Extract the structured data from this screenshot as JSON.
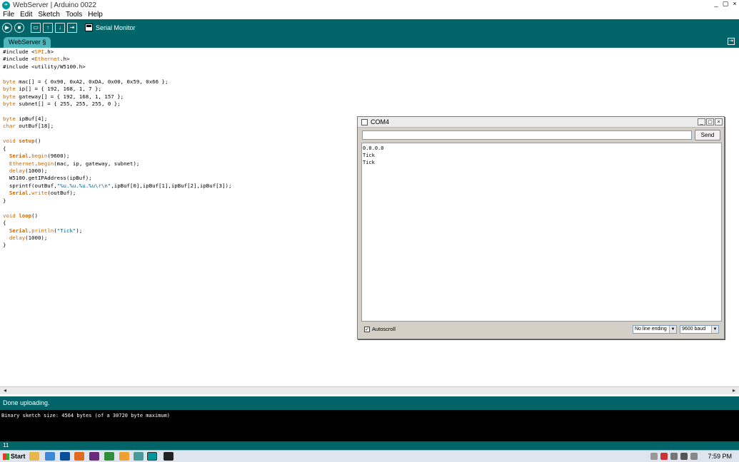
{
  "window": {
    "title": "WebServer | Arduino 0022",
    "controls": [
      "_",
      "▢",
      "×"
    ]
  },
  "menu": [
    "File",
    "Edit",
    "Sketch",
    "Tools",
    "Help"
  ],
  "toolbar": {
    "buttons": [
      "verify",
      "stop",
      "new",
      "open",
      "save",
      "upload"
    ],
    "serial_monitor_label": "Serial Monitor"
  },
  "tab": {
    "label": "WebServer §"
  },
  "editor": {
    "lines": [
      [
        [
          "",
          "#include <"
        ],
        [
          "kw",
          "SPI"
        ],
        [
          "",
          ".h>"
        ]
      ],
      [
        [
          "",
          "#include <"
        ],
        [
          "kw",
          "Ethernet"
        ],
        [
          "",
          ".h>"
        ]
      ],
      [
        [
          "",
          "#include <utility/W5100.h>"
        ]
      ],
      [],
      [
        [
          "kw",
          "byte"
        ],
        [
          "",
          " mac[] = { 0x90, 0xA2, 0xDA, 0x00, 0x59, 0x66 };"
        ]
      ],
      [
        [
          "kw",
          "byte"
        ],
        [
          "",
          " ip[] = { 192, 168, 1, 7 };"
        ]
      ],
      [
        [
          "kw",
          "byte"
        ],
        [
          "",
          " gateway[] = { 192, 168, 1, 157 };"
        ]
      ],
      [
        [
          "kw",
          "byte"
        ],
        [
          "",
          " subnet[] = { 255, 255, 255, 0 };"
        ]
      ],
      [],
      [
        [
          "kw",
          "byte"
        ],
        [
          "",
          " ipBuf[4];"
        ]
      ],
      [
        [
          "kw",
          "char"
        ],
        [
          "",
          " outBuf[18];"
        ]
      ],
      [],
      [
        [
          "kw",
          "void"
        ],
        [
          "",
          " "
        ],
        [
          "kwb",
          "setup"
        ],
        [
          "",
          "()"
        ]
      ],
      [
        [
          "",
          "{"
        ]
      ],
      [
        [
          "",
          "  "
        ],
        [
          "kwb",
          "Serial"
        ],
        [
          "",
          "."
        ],
        [
          "kw",
          "begin"
        ],
        [
          "",
          "(9600);"
        ]
      ],
      [
        [
          "",
          "  "
        ],
        [
          "kw",
          "Ethernet"
        ],
        [
          "",
          "."
        ],
        [
          "kw",
          "begin"
        ],
        [
          "",
          "(mac, ip, gateway, subnet);"
        ]
      ],
      [
        [
          "",
          "  "
        ],
        [
          "kw",
          "delay"
        ],
        [
          "",
          "(1000);"
        ]
      ],
      [
        [
          "",
          "  W5100.getIPAddress(ipBuf);"
        ]
      ],
      [
        [
          "",
          "  sprintf(outBuf,"
        ],
        [
          "str",
          "\"%u.%u.%u.%u\\r\\n\""
        ],
        [
          "",
          ",ipBuf[0],ipBuf[1],ipBuf[2],ipBuf[3]);"
        ]
      ],
      [
        [
          "",
          "  "
        ],
        [
          "kwb",
          "Serial"
        ],
        [
          "",
          "."
        ],
        [
          "kw",
          "write"
        ],
        [
          "",
          "(outBuf);"
        ]
      ],
      [
        [
          "",
          "}"
        ]
      ],
      [],
      [
        [
          "kw",
          "void"
        ],
        [
          "",
          " "
        ],
        [
          "kwb",
          "loop"
        ],
        [
          "",
          "()"
        ]
      ],
      [
        [
          "",
          "{"
        ]
      ],
      [
        [
          "",
          "  "
        ],
        [
          "kwb",
          "Serial"
        ],
        [
          "",
          "."
        ],
        [
          "kw",
          "println"
        ],
        [
          "",
          "("
        ],
        [
          "str",
          "\"Tick\""
        ],
        [
          "",
          ");"
        ]
      ],
      [
        [
          "",
          "  "
        ],
        [
          "kw",
          "delay"
        ],
        [
          "",
          "(1000);"
        ]
      ],
      [
        [
          "",
          "}"
        ]
      ]
    ]
  },
  "status": {
    "message": "Done uploading."
  },
  "console": {
    "text": "Binary sketch size: 4564 bytes (of a 30720 byte maximum)"
  },
  "line_number": "11",
  "serial_monitor": {
    "title": "COM4",
    "input_value": "",
    "send_label": "Send",
    "output": [
      "0.0.0.0",
      "Tick",
      "Tick"
    ],
    "autoscroll_label": "Autoscroll",
    "autoscroll_checked": true,
    "line_ending": "No line ending",
    "baud": "9600 baud"
  },
  "taskbar": {
    "start_label": "Start",
    "clock": "7:59 PM"
  },
  "colors": {
    "teal_dark": "#006468",
    "teal_tab": "#4db7bb",
    "keyword": "#cc6600",
    "string": "#006699"
  }
}
